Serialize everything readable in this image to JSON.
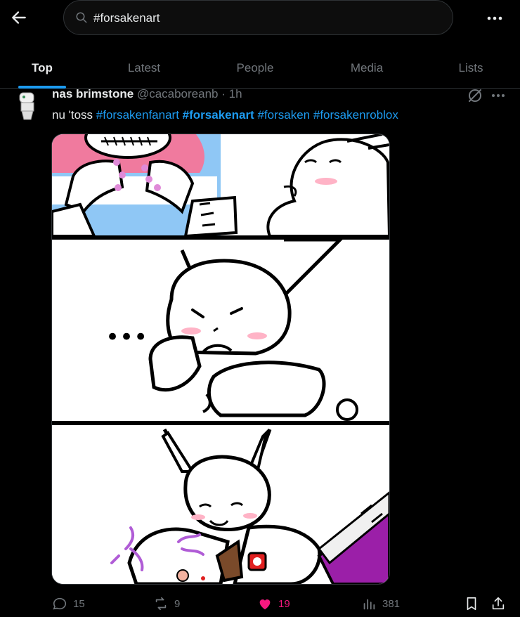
{
  "header": {
    "search_value": "#forsakenart"
  },
  "tabs": [
    {
      "label": "Top",
      "active": true
    },
    {
      "label": "Latest",
      "active": false
    },
    {
      "label": "People",
      "active": false
    },
    {
      "label": "Media",
      "active": false
    },
    {
      "label": "Lists",
      "active": false
    }
  ],
  "tweet": {
    "display_name": "nas brimstone",
    "handle": "@cacaboreanb",
    "separator": "·",
    "time": "1h",
    "text_prefix": "nu 'toss",
    "hashtags": [
      "#forsakenfanart",
      "#forsakenart",
      "#forsaken",
      "#forsakenroblox"
    ],
    "panel_text": "•••",
    "stats": {
      "replies": "15",
      "reposts": "9",
      "likes": "19",
      "views": "381"
    }
  },
  "colors": {
    "background": "#000000",
    "accent": "#1d9bf0",
    "muted": "#71767b",
    "like": "#f91880",
    "border": "#2f3336"
  },
  "icons": {
    "back": "arrow-left-icon",
    "search": "search-icon",
    "more": "more-horizontal-icon",
    "grok": "grok-icon",
    "reply": "reply-icon",
    "repost": "repost-icon",
    "like": "heart-filled-icon",
    "views": "views-chart-icon",
    "bookmark": "bookmark-icon",
    "share": "share-icon"
  }
}
